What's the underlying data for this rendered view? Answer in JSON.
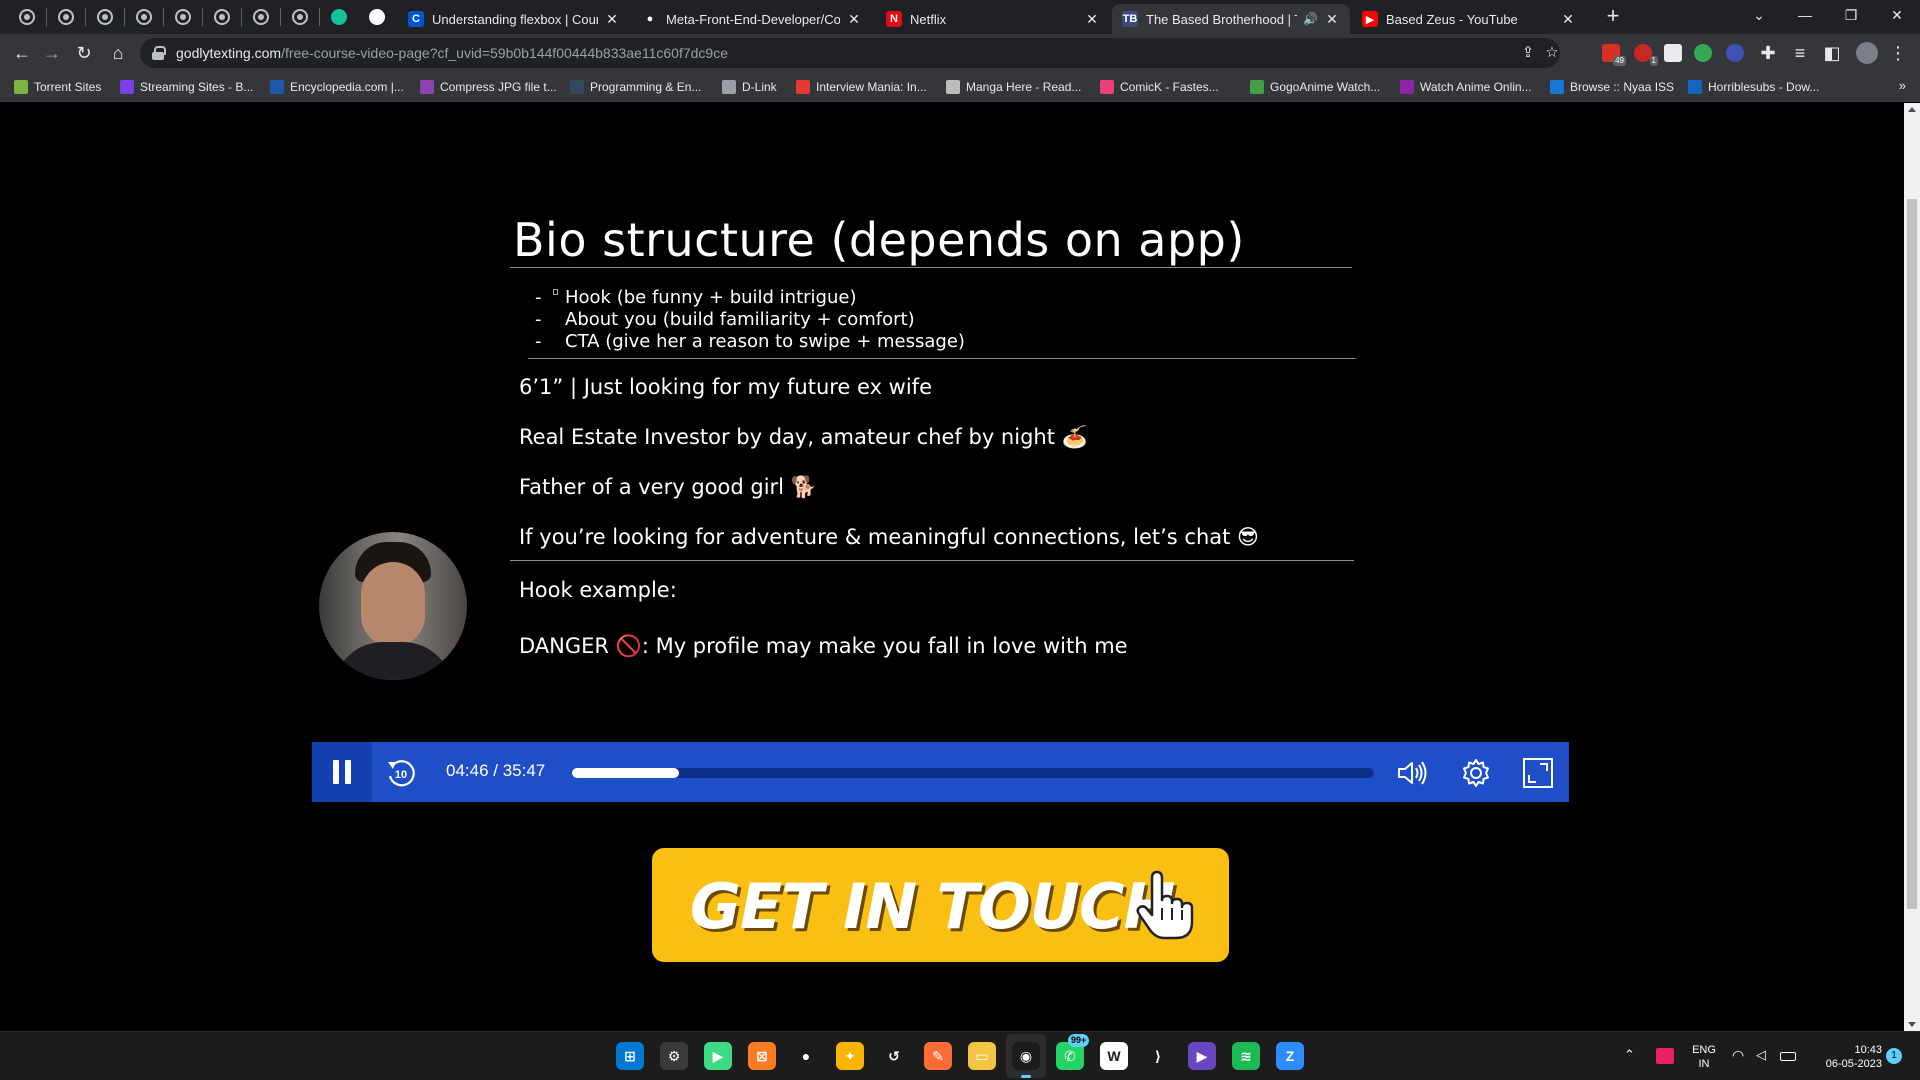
{
  "browser": {
    "pinned_tab_count": 8,
    "tabs": [
      {
        "title": "Understanding flexbox | Coursera",
        "favicon": "coursera-icon",
        "color": "#0056d2",
        "glyph": "C"
      },
      {
        "title": "Meta-Front-End-Developer/Cour",
        "favicon": "github-icon",
        "color": "#202124",
        "glyph": "●"
      },
      {
        "title": "Netflix",
        "favicon": "netflix-icon",
        "color": "#e50914",
        "glyph": "N"
      },
      {
        "title": "The Based Brotherhood | The",
        "favicon": "based-brotherhood-icon",
        "color": "#3c4a7a",
        "glyph": "TB",
        "active": true,
        "audio": true
      },
      {
        "title": "Based Zeus - YouTube",
        "favicon": "youtube-icon",
        "color": "#ff0000",
        "glyph": "▶"
      }
    ],
    "url_host": "godlytexting.com",
    "url_path": "/free-course-video-page?cf_uvid=59b0b144f00444b833ae11c60f7dc9ce",
    "extension_badges": {
      "ext1": "49",
      "ext2": "1"
    },
    "bookmarks": [
      {
        "label": "Torrent Sites",
        "color": "#7cb342"
      },
      {
        "label": "Streaming Sites - B...",
        "color": "#7b3fe4"
      },
      {
        "label": "Encyclopedia.com |...",
        "color": "#1e5aa8"
      },
      {
        "label": "Compress JPG file t...",
        "color": "#8e44ad"
      },
      {
        "label": "Programming & En...",
        "color": "#34495e"
      },
      {
        "label": "D-Link",
        "color": "#9aa0a6"
      },
      {
        "label": "Interview Mania: In...",
        "color": "#e53935"
      },
      {
        "label": "Manga Here - Read...",
        "color": "#bdbdbd"
      },
      {
        "label": "ComicK - Fastes...",
        "color": "#ec407a"
      },
      {
        "label": "GogoAnime Watch...",
        "color": "#43a047"
      },
      {
        "label": "Watch Anime Onlin...",
        "color": "#8e24aa"
      },
      {
        "label": "Browse :: Nyaa ISS",
        "color": "#1976d2"
      },
      {
        "label": "Horriblesubs - Dow...",
        "color": "#1565c0"
      }
    ]
  },
  "slide": {
    "title": "Bio structure (depends on app)",
    "bullets": [
      "Hook (be funny + build intrigue)",
      "About you (build familiarity + comfort)",
      "CTA (give her a reason to swipe + message)"
    ],
    "bio_lines": [
      "6’1” | Just looking for my future ex wife",
      "Real Estate Investor by day, amateur chef by night 🍝",
      "Father of a very good girl 🐕",
      "If you’re looking for adventure & meaningful connections, let’s chat 😎"
    ],
    "hook_heading": "Hook example:",
    "hook_example": "DANGER 🚫: My profile may make you fall in love with me"
  },
  "player": {
    "time": "04:46 / 35:47",
    "rewind_seconds": "10",
    "progress_fraction": 0.133
  },
  "cta": {
    "label": "GET IN TOUCH"
  },
  "taskbar": {
    "apps": [
      {
        "name": "start-icon",
        "color": "#0078d4",
        "glyph": "⊞"
      },
      {
        "name": "settings-icon",
        "color": "#3a3a3a",
        "glyph": "⚙"
      },
      {
        "name": "android-studio-icon",
        "color": "#3ddc84",
        "glyph": "▶"
      },
      {
        "name": "xampp-icon",
        "color": "#fb7a24",
        "glyph": "⊠"
      },
      {
        "name": "mongodb-icon",
        "color": "#1c1c1c",
        "glyph": "●"
      },
      {
        "name": "cyberduck-icon",
        "color": "#f7b500",
        "glyph": "✦"
      },
      {
        "name": "arrow-app-icon",
        "color": "#1c1c1c",
        "glyph": "↺"
      },
      {
        "name": "postman-icon",
        "color": "#ff6c37",
        "glyph": "✎"
      },
      {
        "name": "file-explorer-icon",
        "color": "#f4c542",
        "glyph": "▭"
      },
      {
        "name": "chrome-icon",
        "color": "#1c1c1c",
        "glyph": "◉",
        "active": true
      },
      {
        "name": "whatsapp-icon",
        "color": "#25d366",
        "glyph": "✆",
        "badge": "99+"
      },
      {
        "name": "app-w-icon",
        "color": "#ffffff",
        "glyph": "W"
      },
      {
        "name": "vscode-icon",
        "color": "#1c1c1c",
        "glyph": "⟩"
      },
      {
        "name": "clipchamp-icon",
        "color": "#6b46c1",
        "glyph": "▶"
      },
      {
        "name": "spotify-icon",
        "color": "#1db954",
        "glyph": "≋"
      },
      {
        "name": "zoom-icon",
        "color": "#2d8cff",
        "glyph": "Z"
      }
    ],
    "language_line1": "ENG",
    "language_line2": "IN",
    "time": "10:43",
    "date": "06-05-2023",
    "notification_count": "1"
  }
}
